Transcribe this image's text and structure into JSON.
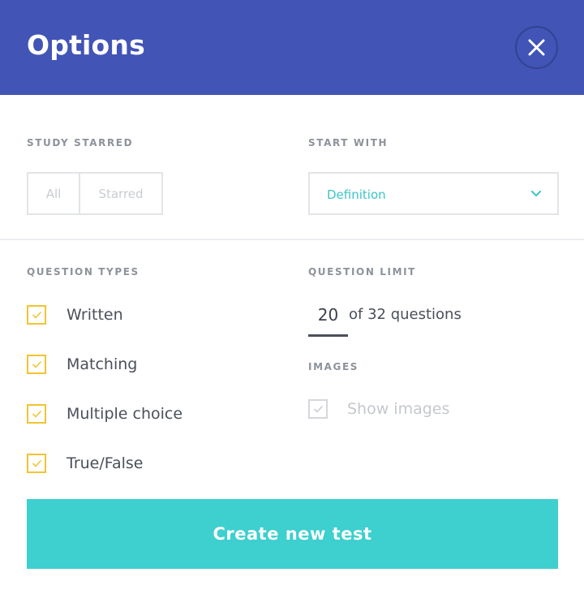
{
  "header": {
    "title": "Options",
    "close_icon": "close-icon",
    "bg_color": "#4254b5"
  },
  "study_starred": {
    "label": "STUDY STARRED",
    "options": [
      "All",
      "Starred"
    ]
  },
  "start_with": {
    "label": "START WITH",
    "selected": "Definition",
    "icon": "chevron-down-icon",
    "accent_color": "#3cc5c9"
  },
  "question_types": {
    "label": "QUESTION TYPES",
    "items": [
      {
        "label": "Written",
        "checked": true
      },
      {
        "label": "Matching",
        "checked": true
      },
      {
        "label": "Multiple choice",
        "checked": true
      },
      {
        "label": "True/False",
        "checked": true
      }
    ],
    "check_color": "#f2c434"
  },
  "question_limit": {
    "label": "QUESTION LIMIT",
    "value": "20",
    "suffix": "of 32 questions"
  },
  "images": {
    "label": "IMAGES",
    "option_label": "Show images",
    "checked": true,
    "disabled": true
  },
  "footer": {
    "create_label": "Create new test",
    "button_color": "#3ecfcf"
  }
}
